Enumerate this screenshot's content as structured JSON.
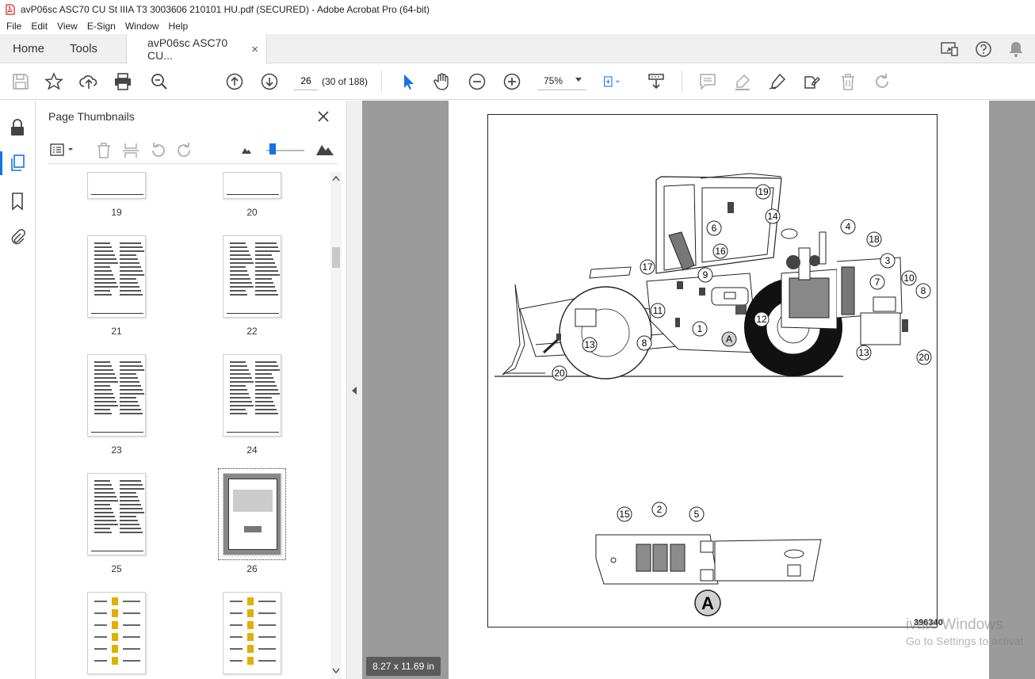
{
  "window": {
    "title": "avP06sc ASC70 CU St IIIA T3 3003606 210101 HU.pdf (SECURED) - Adobe Acrobat Pro (64-bit)"
  },
  "menu": [
    "File",
    "Edit",
    "View",
    "E-Sign",
    "Window",
    "Help"
  ],
  "tabs": {
    "home": "Home",
    "tools": "Tools",
    "document": "avP06sc ASC70 CU...",
    "close": "×"
  },
  "toolbar": {
    "page_value": "26",
    "page_count": "(30 of 188)",
    "zoom": "75%"
  },
  "thumbnails": {
    "title": "Page Thumbnails",
    "close": "×",
    "pages": [
      {
        "label": "19",
        "kind": "blank"
      },
      {
        "label": "20",
        "kind": "blank"
      },
      {
        "label": "21",
        "kind": "text"
      },
      {
        "label": "22",
        "kind": "text"
      },
      {
        "label": "23",
        "kind": "text"
      },
      {
        "label": "24",
        "kind": "text"
      },
      {
        "label": "25",
        "kind": "text"
      },
      {
        "label": "26",
        "kind": "figure",
        "selected": true
      },
      {
        "label": "",
        "kind": "table"
      },
      {
        "label": "",
        "kind": "table"
      }
    ]
  },
  "document": {
    "figure_id": "396340",
    "callouts": [
      "19",
      "14",
      "6",
      "16",
      "9",
      "17",
      "11",
      "1",
      "A",
      "12",
      "13",
      "8",
      "20",
      "4",
      "18",
      "3",
      "7",
      "10",
      "8",
      "13",
      "20"
    ],
    "detail_callouts": [
      "15",
      "2",
      "5"
    ],
    "detail_label": "A"
  },
  "status": {
    "page_size": "8.27 x 11.69 in"
  },
  "watermark": {
    "line1": "ivate Windows",
    "line2": "Go to Settings to activat"
  },
  "colors": {
    "accent": "#1473e6",
    "pdf_red": "#d9261c",
    "doc_background": "#9b9b9b"
  }
}
